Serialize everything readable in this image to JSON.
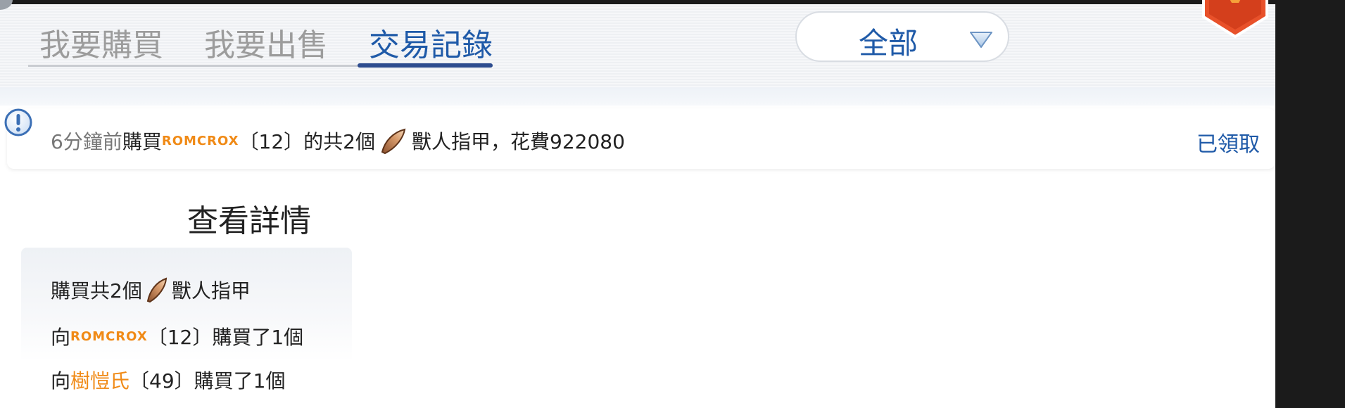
{
  "tabs": [
    {
      "label": "我要購買",
      "active": false
    },
    {
      "label": "我要出售",
      "active": false
    },
    {
      "label": "交易記錄",
      "active": true
    }
  ],
  "filter": {
    "selected": "全部"
  },
  "record": {
    "time": "6分鐘前",
    "action": "購買",
    "seller": "ROMCROX",
    "seller_level": "〔12〕",
    "quantity_text": "的共2個",
    "item_name": "獸人指甲",
    "cost_text": "，花費922080",
    "status": "已領取"
  },
  "details": {
    "title": "查看詳情",
    "summary_prefix": "購買共2個",
    "summary_item": "獸人指甲",
    "rows": [
      {
        "prefix": "向",
        "seller": "ROMCROX",
        "level": "〔12〕",
        "suffix": "購買了1個"
      },
      {
        "prefix": "向",
        "seller": "樹愷氏",
        "level": "〔49〕",
        "suffix": "購買了1個"
      }
    ]
  },
  "icons": {
    "alert": "exclamation-circle-icon",
    "dropdown": "triangle-down-icon",
    "item": "claw-nail-icon",
    "badge": "hexagon-badge-icon"
  },
  "colors": {
    "accent": "#1f5aa8",
    "orange": "#f08a16",
    "inactive_tab": "#9c9c9c"
  }
}
